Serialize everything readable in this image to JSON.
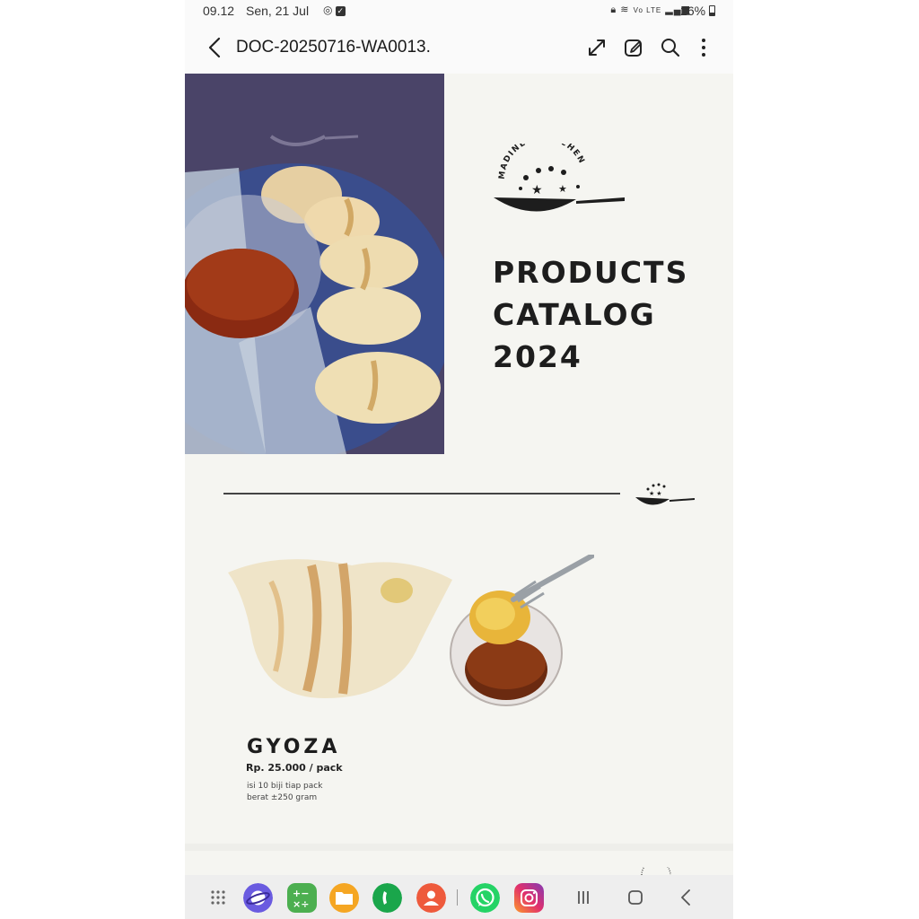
{
  "status_bar": {
    "time": "09.12",
    "date": "Sen, 21 Jul",
    "battery": "26%",
    "icons_left": [
      "nfc-icon",
      "checkbox-notification-icon"
    ],
    "icons_right": [
      "lock-icon",
      "wifi-icon",
      "volte-icon",
      "signal-icon",
      "battery-icon"
    ]
  },
  "app_bar": {
    "title": "DOC-20250716-WA0013.",
    "actions": [
      "expand-icon",
      "edit-icon",
      "search-icon",
      "more-vert-icon"
    ]
  },
  "document": {
    "catalog_title_lines": [
      "PRODUCTS",
      "CATALOG",
      "2024"
    ],
    "brand_logo_text": "MADINE'S KITCHEN",
    "product": {
      "name": "GYOZA",
      "price": "Rp. 25.000 / pack",
      "desc_line1": "isi 10 biji tiap pack",
      "desc_line2": "berat ±250 gram"
    }
  },
  "taskbar": {
    "apps": [
      "app-drawer-icon",
      "samsung-internet-icon",
      "calculator-icon",
      "my-files-icon",
      "phone-icon",
      "contacts-icon",
      "whatsapp-icon",
      "instagram-icon"
    ],
    "nav": [
      "recents-icon",
      "home-icon",
      "back-icon"
    ]
  },
  "colors": {
    "hero_bg": "#4a4468",
    "page_bg": "#f5f5f1",
    "text_dark": "#1d1d1d"
  }
}
